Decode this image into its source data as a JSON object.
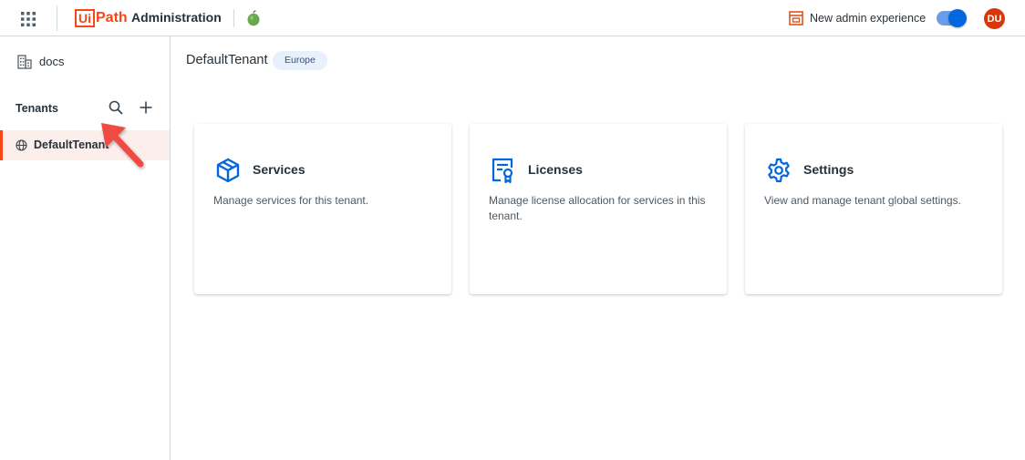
{
  "header": {
    "logo_ui": "Ui",
    "logo_path": "Path",
    "app_name": "Administration",
    "new_experience_label": "New admin experience",
    "toggle_on": true,
    "avatar_initials": "DU",
    "accent_color": "#fa4616",
    "toggle_color": "#0067df",
    "avatar_color": "#d8370c"
  },
  "sidebar": {
    "org_label": "docs",
    "tenants_heading": "Tenants",
    "tenants": [
      {
        "label": "DefaultTenant",
        "selected": true
      }
    ]
  },
  "main": {
    "title": "DefaultTenant",
    "region": "Europe",
    "cards": [
      {
        "icon": "box-icon",
        "title": "Services",
        "description": "Manage services for this tenant."
      },
      {
        "icon": "license-certificate-icon",
        "title": "Licenses",
        "description": "Manage license allocation for services in this tenant."
      },
      {
        "icon": "gear-icon",
        "title": "Settings",
        "description": "View and manage tenant global settings."
      }
    ]
  }
}
